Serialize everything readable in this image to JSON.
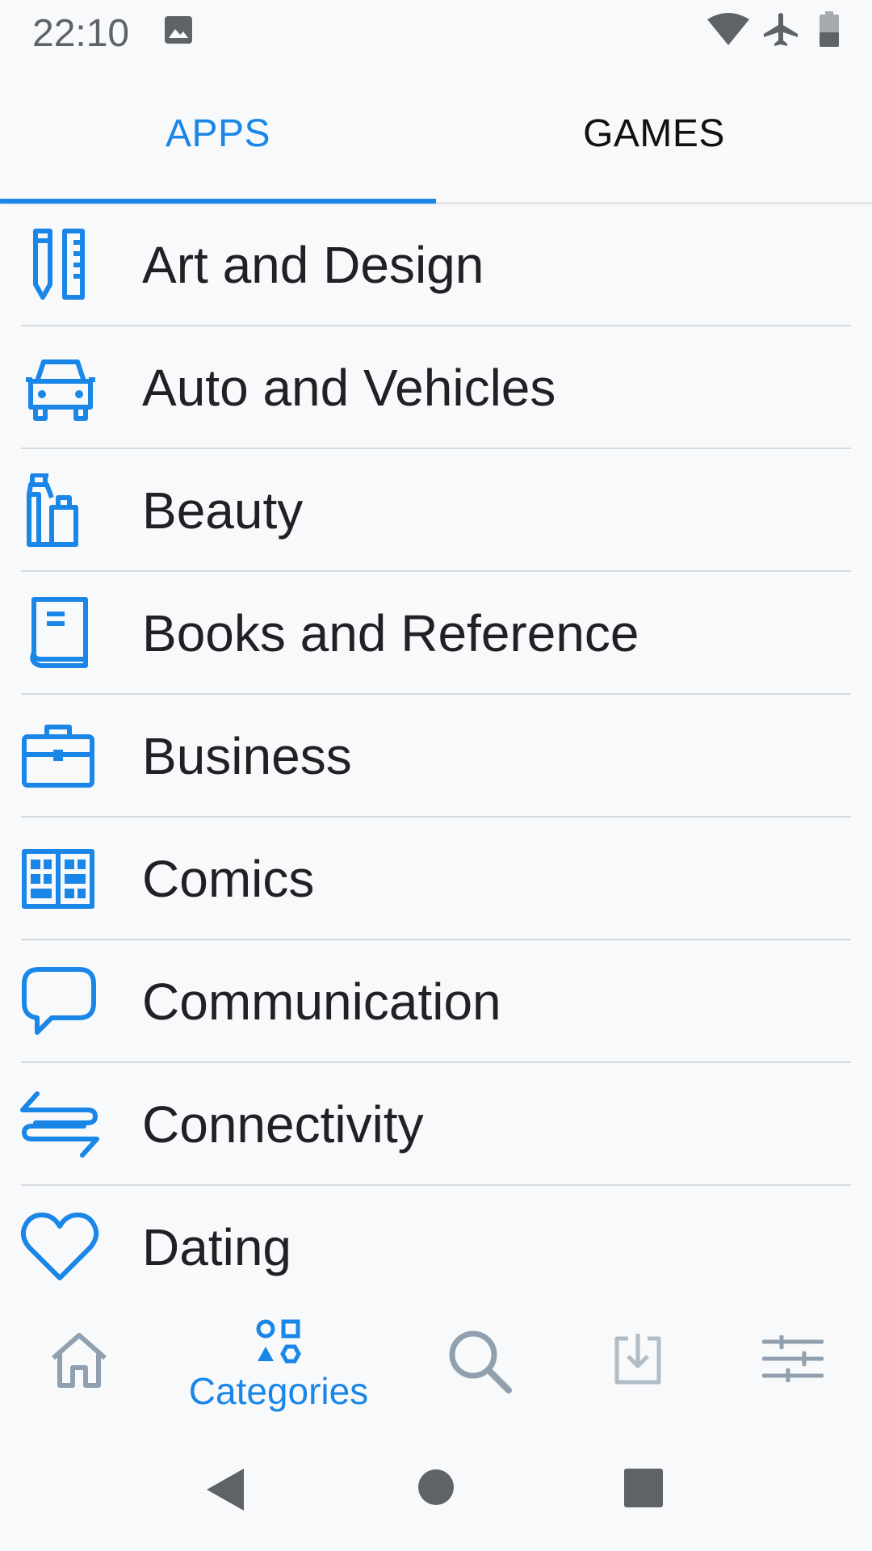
{
  "status_bar": {
    "time": "22:10",
    "icons": [
      "image-icon",
      "wifi-icon",
      "airplane-mode-icon",
      "battery-icon"
    ]
  },
  "tabs": [
    {
      "label": "APPS",
      "selected": true
    },
    {
      "label": "GAMES",
      "selected": false
    }
  ],
  "categories": [
    {
      "label": "Art and Design",
      "icon": "art-design-icon"
    },
    {
      "label": "Auto and Vehicles",
      "icon": "car-icon"
    },
    {
      "label": "Beauty",
      "icon": "beauty-bottles-icon"
    },
    {
      "label": "Books and Reference",
      "icon": "book-icon"
    },
    {
      "label": "Business",
      "icon": "briefcase-icon"
    },
    {
      "label": "Comics",
      "icon": "comic-book-icon"
    },
    {
      "label": "Communication",
      "icon": "chat-bubble-icon"
    },
    {
      "label": "Connectivity",
      "icon": "connectivity-arrows-icon"
    },
    {
      "label": "Dating",
      "icon": "heart-icon"
    }
  ],
  "bottom_nav": {
    "items": [
      {
        "id": "home",
        "icon": "home-icon",
        "label": "",
        "active": false
      },
      {
        "id": "categories",
        "icon": "categories-icon",
        "label": "Categories",
        "active": true
      },
      {
        "id": "search",
        "icon": "search-icon",
        "label": "",
        "active": false
      },
      {
        "id": "downloads",
        "icon": "download-icon",
        "label": "",
        "active": false
      },
      {
        "id": "settings",
        "icon": "settings-sliders-icon",
        "label": "",
        "active": false
      }
    ]
  },
  "colors": {
    "accent": "#1a86e8",
    "inactive_icon": "#90a0ae",
    "text": "#202124",
    "background": "#f8f9fa"
  }
}
